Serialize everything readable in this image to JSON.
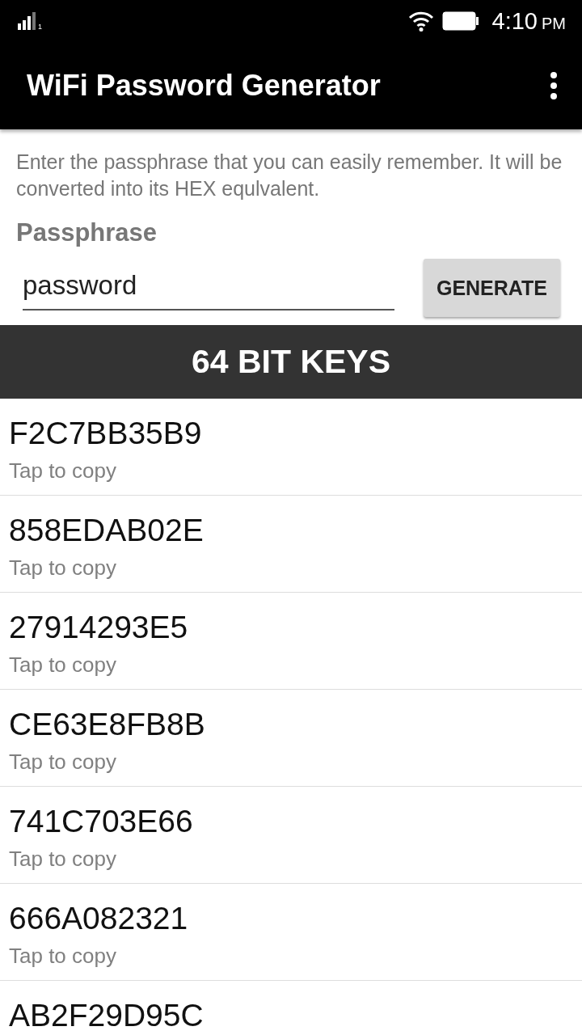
{
  "status_bar": {
    "sim_label": "1",
    "time": "4:10",
    "meridiem": "PM"
  },
  "app_bar": {
    "title": "WiFi Password Generator"
  },
  "intro": "Enter the passphrase that you can easily remember. It will be converted into its HEX equlvalent.",
  "passphrase": {
    "label": "Passphrase",
    "value": "password",
    "button": "GENERATE"
  },
  "section_header": "64 BIT KEYS",
  "keys": [
    {
      "key": "F2C7BB35B9",
      "hint": "Tap to copy"
    },
    {
      "key": "858EDAB02E",
      "hint": "Tap to copy"
    },
    {
      "key": "27914293E5",
      "hint": "Tap to copy"
    },
    {
      "key": "CE63E8FB8B",
      "hint": "Tap to copy"
    },
    {
      "key": "741C703E66",
      "hint": "Tap to copy"
    },
    {
      "key": "666A082321",
      "hint": "Tap to copy"
    },
    {
      "key": "AB2F29D95C"
    }
  ]
}
